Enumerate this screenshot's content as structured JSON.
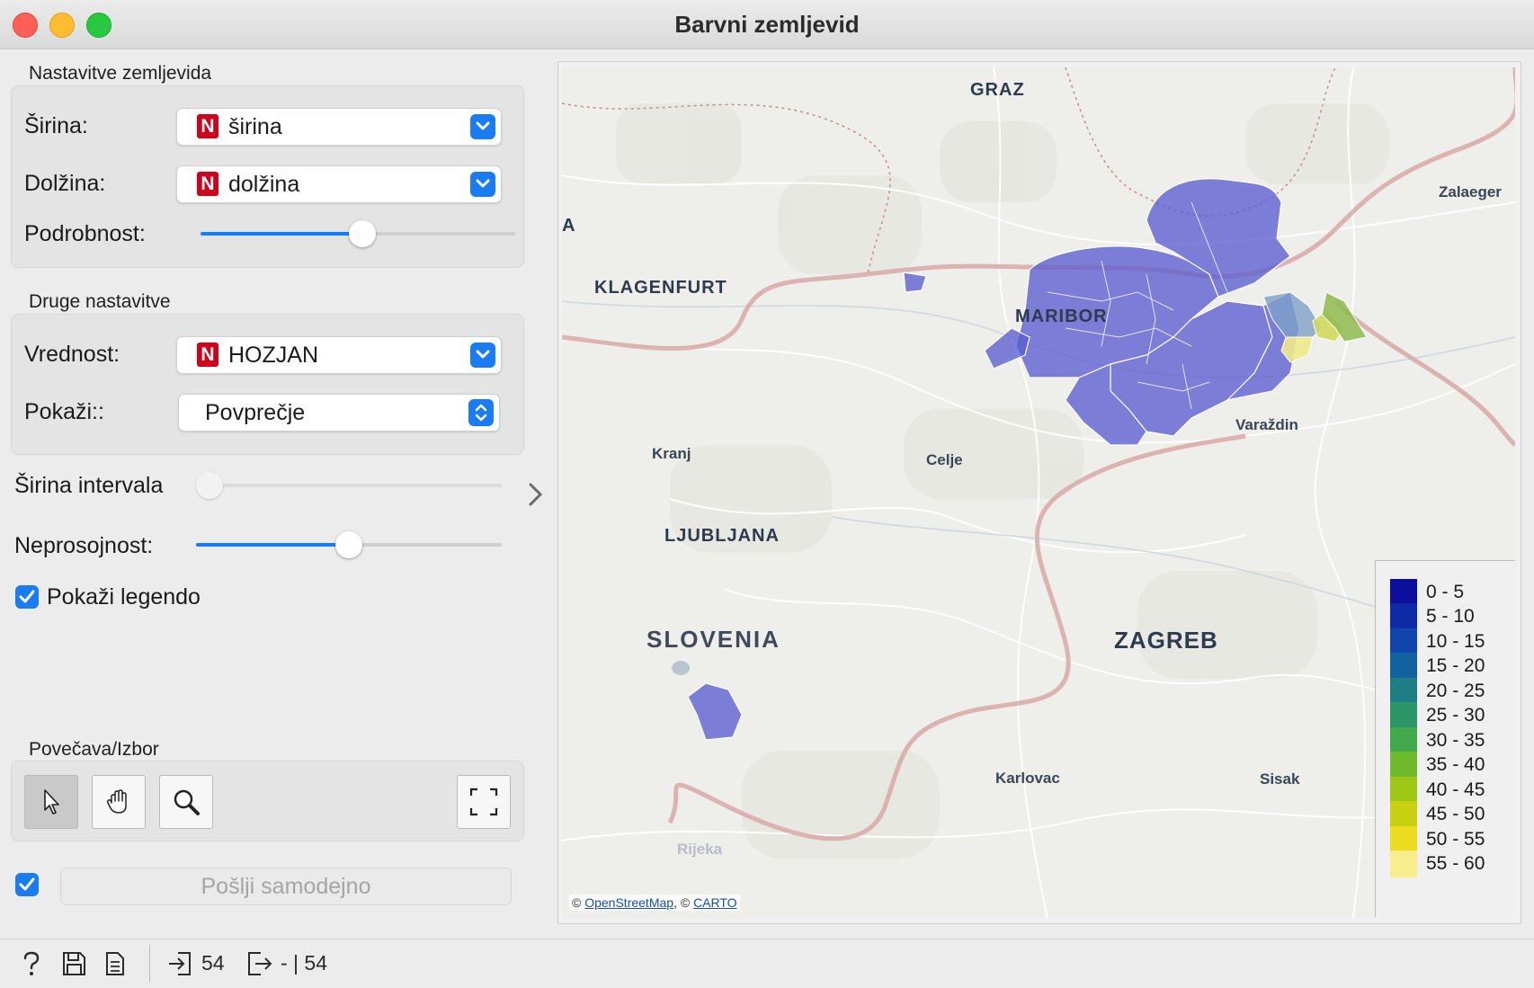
{
  "window": {
    "title": "Barvni zemljevid"
  },
  "map_settings": {
    "section_label": "Nastavitve zemljevida",
    "latitude": {
      "label": "Širina:",
      "type_badge": "N",
      "value": "širina"
    },
    "longitude": {
      "label": "Dolžina:",
      "type_badge": "N",
      "value": "dolžina"
    },
    "detail": {
      "label": "Podrobnost:",
      "level": 0.5
    }
  },
  "other_settings": {
    "section_label": "Druge nastavitve",
    "value": {
      "label": "Vrednost:",
      "type_badge": "N",
      "value": "HOZJAN"
    },
    "show": {
      "label": "Pokaži::",
      "value": "Povprečje"
    }
  },
  "bin_width": {
    "label": "Širina intervala",
    "level": 0.0
  },
  "opacity": {
    "label": "Neprosojnost:",
    "level": 0.5
  },
  "show_legend": {
    "label": "Pokaži legendo",
    "checked": true
  },
  "zoom_select": {
    "section_label": "Povečava/Izbor",
    "tools": [
      "select-tool",
      "pan-tool",
      "zoom-tool",
      "fit-view"
    ]
  },
  "send": {
    "label": "Pošlji samodejno",
    "checked": true
  },
  "map": {
    "cities": [
      "GRAZ",
      "KLAGENFURT",
      "MARIBOR",
      "Zalaeger",
      "Varaždin",
      "Kranj",
      "Celje",
      "LJUBLJANA",
      "SLOVENIA",
      "ZAGREB",
      "Karlovac",
      "Sisak",
      "Rijeka",
      "A"
    ],
    "attribution": {
      "prefix1": "©",
      "osm": "OpenStreetMap",
      "prefix2": ", ©",
      "carto": "CARTO"
    },
    "legend": [
      {
        "label": "0 - 5",
        "color": "#0c0f9e"
      },
      {
        "label": "5 - 10",
        "color": "#0e2aa6"
      },
      {
        "label": "10 - 15",
        "color": "#0f45ad"
      },
      {
        "label": "15 - 20",
        "color": "#1262a0"
      },
      {
        "label": "20 - 25",
        "color": "#1f7d86"
      },
      {
        "label": "25 - 30",
        "color": "#2c956a"
      },
      {
        "label": "30 - 35",
        "color": "#42a94c"
      },
      {
        "label": "35 - 40",
        "color": "#6fba2d"
      },
      {
        "label": "40 - 45",
        "color": "#9ec617"
      },
      {
        "label": "45 - 50",
        "color": "#c9d012"
      },
      {
        "label": "50 - 55",
        "color": "#ecdc1f"
      },
      {
        "label": "55 - 60",
        "color": "#f8ee8e"
      }
    ]
  },
  "statusbar": {
    "input_count": "54",
    "output_text": "- | 54"
  }
}
